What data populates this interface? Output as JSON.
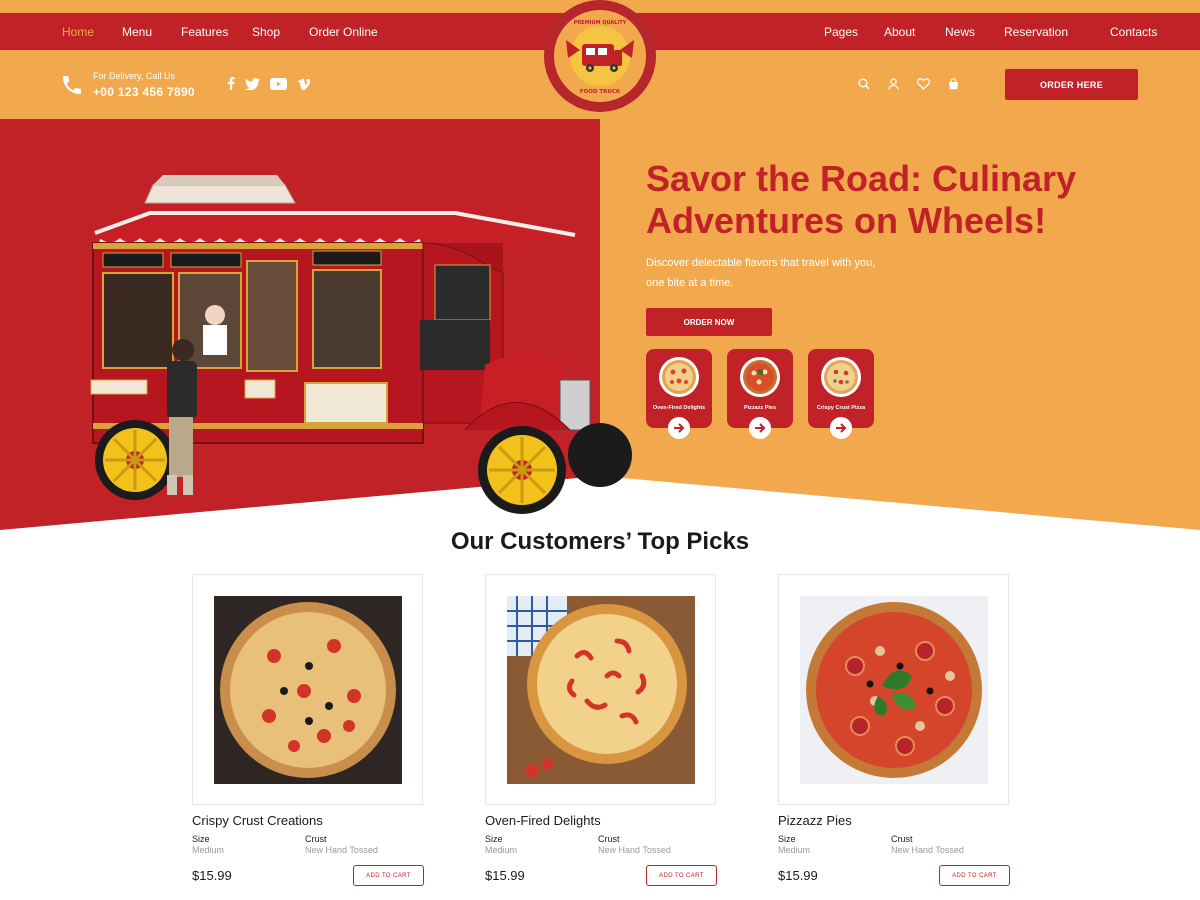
{
  "nav": {
    "left": [
      {
        "label": "Home",
        "active": true
      },
      {
        "label": "Menu"
      },
      {
        "label": "Features"
      },
      {
        "label": "Shop"
      },
      {
        "label": "Order Online"
      }
    ],
    "right": [
      {
        "label": "Pages"
      },
      {
        "label": "About"
      },
      {
        "label": "News"
      },
      {
        "label": "Reservation"
      },
      {
        "label": "Contacts"
      }
    ]
  },
  "logo": {
    "top_text": "PREMIUM QUALITY",
    "bottom_text": "FOOD TRUCK"
  },
  "contact": {
    "label": "For Delivery, Call Us",
    "phone": "+00 123 456 7890"
  },
  "social": [
    "facebook-icon",
    "twitter-icon",
    "youtube-icon",
    "vimeo-icon"
  ],
  "tools": [
    "search-icon",
    "user-icon",
    "heart-icon",
    "cart-icon"
  ],
  "order_here": "ORDER HERE",
  "hero": {
    "title": "Savor the Road: Culinary Adventures on Wheels!",
    "description": "Discover delectable flavors that travel with you, one bite at a time.",
    "cta": "ORDER NOW",
    "categories": [
      {
        "label": "Oven-Fired Delights"
      },
      {
        "label": "Pizzazz Pies"
      },
      {
        "label": "Crispy Crust Pizza"
      }
    ]
  },
  "picks": {
    "title": "Our Customers’ Top Picks",
    "size_label": "Size",
    "crust_label": "Crust",
    "cart_label": "ADD TO CART",
    "items": [
      {
        "name": "Crispy Crust Creations",
        "size": "Medium",
        "crust": "New Hand Tossed",
        "price": "$15.99"
      },
      {
        "name": "Oven-Fired Delights",
        "size": "Medium",
        "crust": "New Hand Tossed",
        "price": "$15.99"
      },
      {
        "name": "Pizzazz Pies",
        "size": "Medium",
        "crust": "New Hand Tossed",
        "price": "$15.99"
      }
    ]
  },
  "colors": {
    "red": "#c02227",
    "orange": "#f2a94d",
    "white": "#ffffff"
  }
}
